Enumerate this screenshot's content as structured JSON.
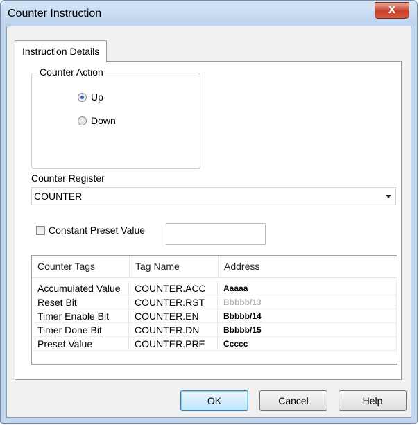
{
  "window": {
    "title": "Counter Instruction",
    "close_glyph": "X"
  },
  "tabs": [
    {
      "label": "Instruction Details",
      "active": true
    }
  ],
  "counter_action": {
    "legend": "Counter Action",
    "options": [
      {
        "label": "Up",
        "checked": true
      },
      {
        "label": "Down",
        "checked": false
      }
    ]
  },
  "counter_register": {
    "label": "Counter Register",
    "value": "COUNTER"
  },
  "preset": {
    "checkbox_label": "Constant Preset Value",
    "checked": false,
    "value": ""
  },
  "table": {
    "headers": [
      "Counter Tags",
      "Tag Name",
      "Address"
    ],
    "rows": [
      {
        "tag": "Accumulated Value",
        "name": "COUNTER.ACC",
        "address": "Aaaaa",
        "address_dimmed": false
      },
      {
        "tag": "Reset Bit",
        "name": "COUNTER.RST",
        "address": "Bbbbb/13",
        "address_dimmed": true
      },
      {
        "tag": "Timer Enable Bit",
        "name": "COUNTER.EN",
        "address": "Bbbbb/14",
        "address_dimmed": false
      },
      {
        "tag": "Timer Done Bit",
        "name": "COUNTER.DN",
        "address": "Bbbbb/15",
        "address_dimmed": false
      },
      {
        "tag": "Preset Value",
        "name": "COUNTER.PRE",
        "address": "Ccccc",
        "address_dimmed": false
      }
    ]
  },
  "buttons": {
    "ok": "OK",
    "cancel": "Cancel",
    "help": "Help"
  },
  "colors": {
    "titlebar": "#c2d7ee",
    "dialog_bg": "#f0f0f0",
    "close_button": "#c6402b",
    "radio_dot": "#2b6cc2",
    "dim_text": "#b5b5b5"
  }
}
